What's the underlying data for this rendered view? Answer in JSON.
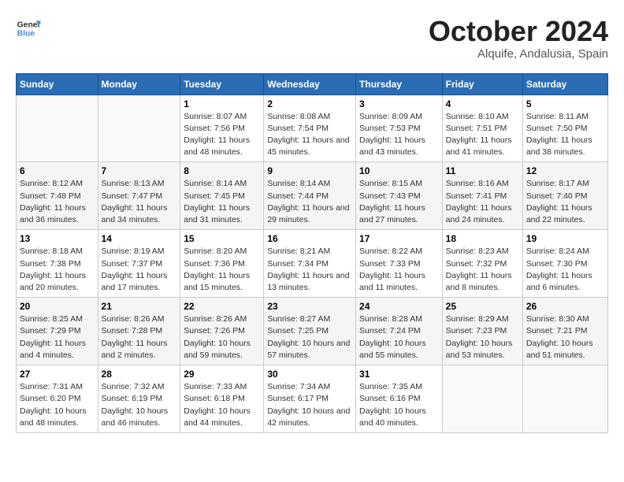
{
  "header": {
    "logo_line1": "General",
    "logo_line2": "Blue",
    "month": "October 2024",
    "location": "Alquife, Andalusia, Spain"
  },
  "days_of_week": [
    "Sunday",
    "Monday",
    "Tuesday",
    "Wednesday",
    "Thursday",
    "Friday",
    "Saturday"
  ],
  "weeks": [
    [
      {
        "day": "",
        "info": ""
      },
      {
        "day": "",
        "info": ""
      },
      {
        "day": "1",
        "info": "Sunrise: 8:07 AM\nSunset: 7:56 PM\nDaylight: 11 hours and 48 minutes."
      },
      {
        "day": "2",
        "info": "Sunrise: 8:08 AM\nSunset: 7:54 PM\nDaylight: 11 hours and 45 minutes."
      },
      {
        "day": "3",
        "info": "Sunrise: 8:09 AM\nSunset: 7:53 PM\nDaylight: 11 hours and 43 minutes."
      },
      {
        "day": "4",
        "info": "Sunrise: 8:10 AM\nSunset: 7:51 PM\nDaylight: 11 hours and 41 minutes."
      },
      {
        "day": "5",
        "info": "Sunrise: 8:11 AM\nSunset: 7:50 PM\nDaylight: 11 hours and 38 minutes."
      }
    ],
    [
      {
        "day": "6",
        "info": "Sunrise: 8:12 AM\nSunset: 7:48 PM\nDaylight: 11 hours and 36 minutes."
      },
      {
        "day": "7",
        "info": "Sunrise: 8:13 AM\nSunset: 7:47 PM\nDaylight: 11 hours and 34 minutes."
      },
      {
        "day": "8",
        "info": "Sunrise: 8:14 AM\nSunset: 7:45 PM\nDaylight: 11 hours and 31 minutes."
      },
      {
        "day": "9",
        "info": "Sunrise: 8:14 AM\nSunset: 7:44 PM\nDaylight: 11 hours and 29 minutes."
      },
      {
        "day": "10",
        "info": "Sunrise: 8:15 AM\nSunset: 7:43 PM\nDaylight: 11 hours and 27 minutes."
      },
      {
        "day": "11",
        "info": "Sunrise: 8:16 AM\nSunset: 7:41 PM\nDaylight: 11 hours and 24 minutes."
      },
      {
        "day": "12",
        "info": "Sunrise: 8:17 AM\nSunset: 7:40 PM\nDaylight: 11 hours and 22 minutes."
      }
    ],
    [
      {
        "day": "13",
        "info": "Sunrise: 8:18 AM\nSunset: 7:38 PM\nDaylight: 11 hours and 20 minutes."
      },
      {
        "day": "14",
        "info": "Sunrise: 8:19 AM\nSunset: 7:37 PM\nDaylight: 11 hours and 17 minutes."
      },
      {
        "day": "15",
        "info": "Sunrise: 8:20 AM\nSunset: 7:36 PM\nDaylight: 11 hours and 15 minutes."
      },
      {
        "day": "16",
        "info": "Sunrise: 8:21 AM\nSunset: 7:34 PM\nDaylight: 11 hours and 13 minutes."
      },
      {
        "day": "17",
        "info": "Sunrise: 8:22 AM\nSunset: 7:33 PM\nDaylight: 11 hours and 11 minutes."
      },
      {
        "day": "18",
        "info": "Sunrise: 8:23 AM\nSunset: 7:32 PM\nDaylight: 11 hours and 8 minutes."
      },
      {
        "day": "19",
        "info": "Sunrise: 8:24 AM\nSunset: 7:30 PM\nDaylight: 11 hours and 6 minutes."
      }
    ],
    [
      {
        "day": "20",
        "info": "Sunrise: 8:25 AM\nSunset: 7:29 PM\nDaylight: 11 hours and 4 minutes."
      },
      {
        "day": "21",
        "info": "Sunrise: 8:26 AM\nSunset: 7:28 PM\nDaylight: 11 hours and 2 minutes."
      },
      {
        "day": "22",
        "info": "Sunrise: 8:26 AM\nSunset: 7:26 PM\nDaylight: 10 hours and 59 minutes."
      },
      {
        "day": "23",
        "info": "Sunrise: 8:27 AM\nSunset: 7:25 PM\nDaylight: 10 hours and 57 minutes."
      },
      {
        "day": "24",
        "info": "Sunrise: 8:28 AM\nSunset: 7:24 PM\nDaylight: 10 hours and 55 minutes."
      },
      {
        "day": "25",
        "info": "Sunrise: 8:29 AM\nSunset: 7:23 PM\nDaylight: 10 hours and 53 minutes."
      },
      {
        "day": "26",
        "info": "Sunrise: 8:30 AM\nSunset: 7:21 PM\nDaylight: 10 hours and 51 minutes."
      }
    ],
    [
      {
        "day": "27",
        "info": "Sunrise: 7:31 AM\nSunset: 6:20 PM\nDaylight: 10 hours and 48 minutes."
      },
      {
        "day": "28",
        "info": "Sunrise: 7:32 AM\nSunset: 6:19 PM\nDaylight: 10 hours and 46 minutes."
      },
      {
        "day": "29",
        "info": "Sunrise: 7:33 AM\nSunset: 6:18 PM\nDaylight: 10 hours and 44 minutes."
      },
      {
        "day": "30",
        "info": "Sunrise: 7:34 AM\nSunset: 6:17 PM\nDaylight: 10 hours and 42 minutes."
      },
      {
        "day": "31",
        "info": "Sunrise: 7:35 AM\nSunset: 6:16 PM\nDaylight: 10 hours and 40 minutes."
      },
      {
        "day": "",
        "info": ""
      },
      {
        "day": "",
        "info": ""
      }
    ]
  ]
}
